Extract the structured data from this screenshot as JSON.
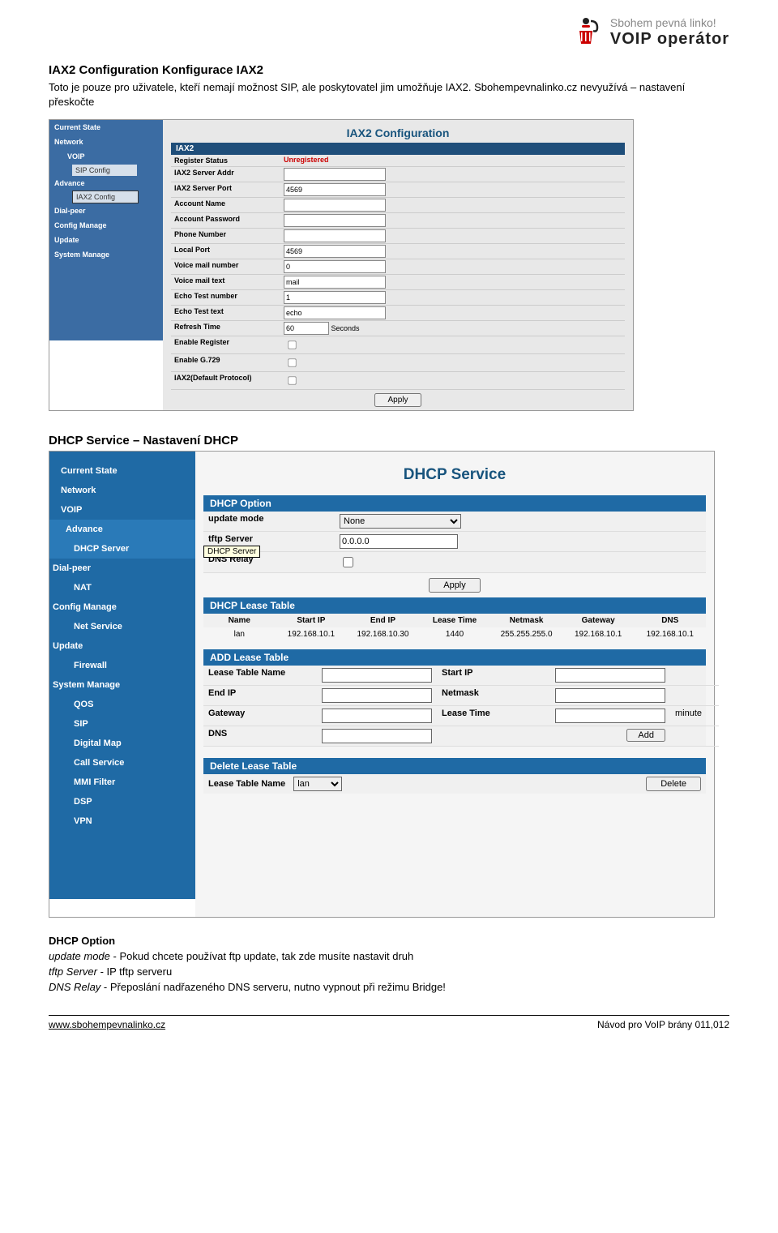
{
  "brand": {
    "tagline": "Sbohem pevná linko!",
    "name": "VOIP operátor"
  },
  "sec1": {
    "title": "IAX2 Configuration  Konfigurace IAX2",
    "p1": "Toto je pouze pro uživatele, kteří nemají možnost SIP, ale poskytovatel jim umožňuje IAX2. Sbohempevnalinko.cz nevyužívá – nastavení přeskočte"
  },
  "iax2": {
    "nav": {
      "current": "Current State",
      "network": "Network",
      "voip": "VOIP",
      "sipconfig": "SIP Config",
      "advance": "Advance",
      "iax": "IAX2 Config",
      "dialpeer": "Dial-peer",
      "config": "Config Manage",
      "update": "Update",
      "system": "System Manage"
    },
    "title": "IAX2 Configuration",
    "bar": "IAX2",
    "rows": {
      "reg_status": "Register Status",
      "reg_status_val": "Unregistered",
      "server_addr": "IAX2 Server Addr",
      "server_addr_val": "",
      "server_port": "IAX2 Server Port",
      "server_port_val": "4569",
      "acct_name": "Account Name",
      "acct_name_val": "",
      "acct_pw": "Account Password",
      "acct_pw_val": "",
      "phone": "Phone Number",
      "phone_val": "",
      "local_port": "Local Port",
      "local_port_val": "4569",
      "vm_num": "Voice mail number",
      "vm_num_val": "0",
      "vm_text": "Voice mail text",
      "vm_text_val": "mail",
      "echo_num": "Echo Test number",
      "echo_num_val": "1",
      "echo_text": "Echo Test text",
      "echo_text_val": "echo",
      "refresh": "Refresh Time",
      "refresh_val": "60",
      "refresh_unit": "Seconds",
      "enable_reg": "Enable Register",
      "enable_g729": "Enable G.729",
      "default_proto": "IAX2(Default Protocol)"
    },
    "apply": "Apply"
  },
  "sec2": {
    "title": "DHCP Service – Nastavení DHCP"
  },
  "dhcp": {
    "nav1": [
      "Current State",
      "Network",
      "VOIP",
      "Advance",
      "Dial-peer",
      "Config Manage",
      "Update",
      "System Manage"
    ],
    "nav2": [
      "DHCP Server",
      "NAT",
      "Net Service",
      "Firewall",
      "QOS",
      "SIP",
      "Digital Map",
      "Call Service",
      "MMI Filter",
      "DSP",
      "VPN"
    ],
    "tip": "DHCP Server",
    "title": "DHCP Service",
    "option": {
      "bar": "DHCP Option",
      "update_mode_lbl": "update mode",
      "update_mode_val": "None",
      "tftp_lbl": "tftp Server",
      "tftp_val": "0.0.0.0",
      "dns_relay_lbl": "DNS Relay",
      "apply": "Apply"
    },
    "lease": {
      "bar": "DHCP Lease Table",
      "head": [
        "Name",
        "Start IP",
        "End IP",
        "Lease Time",
        "Netmask",
        "Gateway",
        "DNS"
      ],
      "row": [
        "lan",
        "192.168.10.1",
        "192.168.10.30",
        "1440",
        "255.255.255.0",
        "192.168.10.1",
        "192.168.10.1"
      ]
    },
    "add": {
      "bar": "ADD Lease Table",
      "name_lbl": "Lease Table Name",
      "startip_lbl": "Start IP",
      "endip_lbl": "End IP",
      "netmask_lbl": "Netmask",
      "gateway_lbl": "Gateway",
      "leasetime_lbl": "Lease Time",
      "minute": "minute",
      "dns_lbl": "DNS",
      "add_btn": "Add"
    },
    "del": {
      "bar": "Delete Lease Table",
      "name_lbl": "Lease Table Name",
      "sel": "lan",
      "btn": "Delete"
    }
  },
  "desc": {
    "heading": "DHCP Option",
    "l1_i": "update mode",
    "l1_t": " - Pokud chcete používat ftp update, tak zde musíte nastavit druh",
    "l2_i": "tftp Server",
    "l2_t": " - IP tftp serveru",
    "l3_i": "DNS Relay",
    "l3_t": " - Přeposlání nadřazeného DNS serveru, nutno vypnout při režimu Bridge!"
  },
  "footer": {
    "url": "www.sbohempevnalinko.cz",
    "doc": "Návod pro VoIP brány 011,012"
  }
}
